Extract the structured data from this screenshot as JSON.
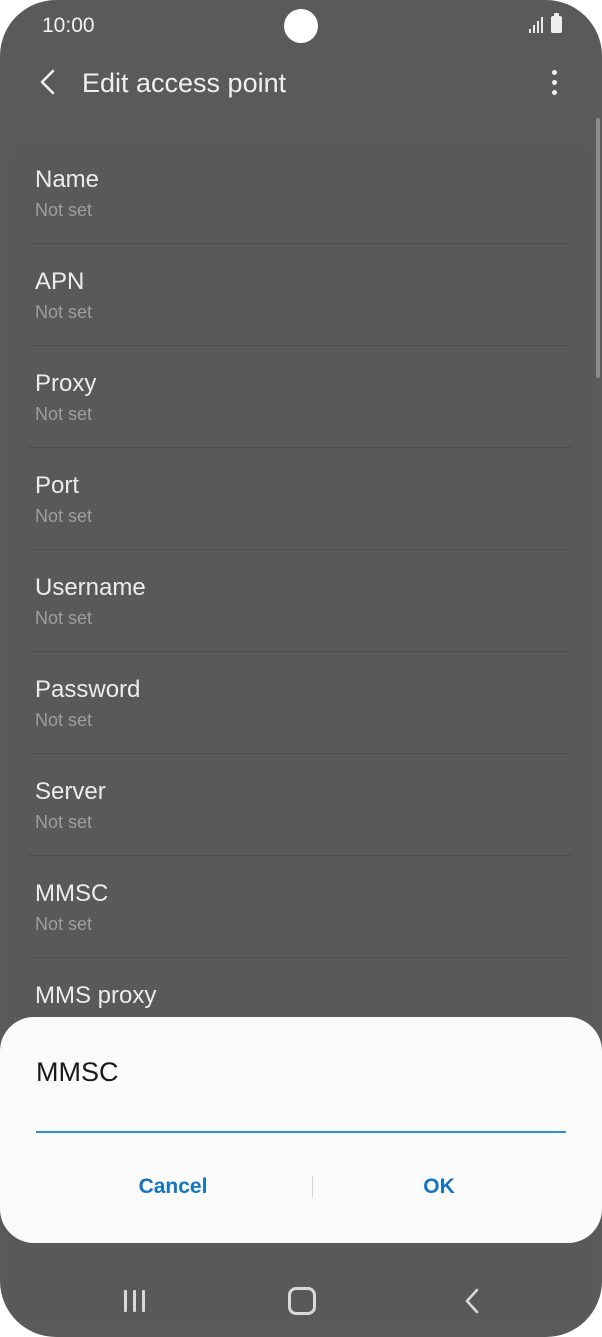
{
  "status_bar": {
    "time": "10:00"
  },
  "app_bar": {
    "title": "Edit access point"
  },
  "settings": [
    {
      "title": "Name",
      "value": "Not set"
    },
    {
      "title": "APN",
      "value": "Not set"
    },
    {
      "title": "Proxy",
      "value": "Not set"
    },
    {
      "title": "Port",
      "value": "Not set"
    },
    {
      "title": "Username",
      "value": "Not set"
    },
    {
      "title": "Password",
      "value": "Not set"
    },
    {
      "title": "Server",
      "value": "Not set"
    },
    {
      "title": "MMSC",
      "value": "Not set"
    },
    {
      "title": "MMS proxy",
      "value": ""
    }
  ],
  "dialog": {
    "title": "MMSC",
    "input_value": "",
    "cancel_label": "Cancel",
    "ok_label": "OK"
  },
  "icons": {
    "back": "chevron-left-icon",
    "more": "more-vertical-icon",
    "signal": "signal-icon",
    "battery": "battery-icon",
    "recents": "recents-icon",
    "home": "home-icon",
    "nav_back": "back-icon"
  },
  "colors": {
    "accent": "#1474c4",
    "input_underline": "#2f8fd1",
    "background_dimmed": "#5a5a5a",
    "dialog_bg": "#fbfbfb"
  }
}
